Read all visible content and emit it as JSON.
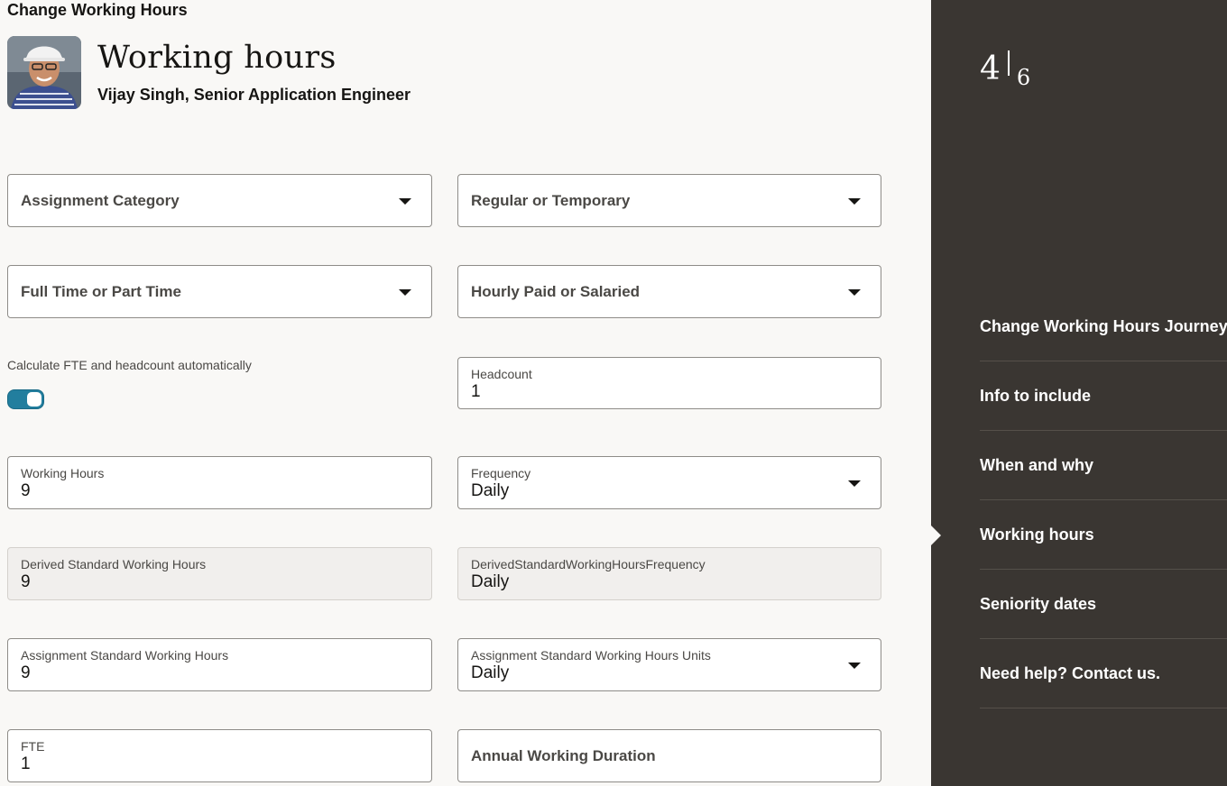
{
  "page": {
    "heading": "Change Working Hours",
    "title": "Working hours",
    "subtitle": "Vijay Singh, Senior Application Engineer"
  },
  "form": {
    "assignment_category": {
      "placeholder": "Assignment Category"
    },
    "regular_or_temporary": {
      "placeholder": "Regular or Temporary"
    },
    "full_or_part_time": {
      "placeholder": "Full Time or Part Time"
    },
    "hourly_or_salaried": {
      "placeholder": "Hourly Paid or Salaried"
    },
    "calculate_fte_toggle": {
      "label": "Calculate FTE and headcount automatically",
      "on": true
    },
    "headcount": {
      "label": "Headcount",
      "value": "1"
    },
    "working_hours": {
      "label": "Working Hours",
      "value": "9"
    },
    "frequency": {
      "label": "Frequency",
      "value": "Daily"
    },
    "derived_standard_working_hours": {
      "label": "Derived Standard Working Hours",
      "value": "9"
    },
    "derived_standard_working_hours_frequency": {
      "label": "DerivedStandardWorkingHoursFrequency",
      "value": "Daily"
    },
    "assignment_standard_working_hours": {
      "label": "Assignment Standard Working Hours",
      "value": "9"
    },
    "assignment_standard_working_hours_units": {
      "label": "Assignment Standard Working Hours Units",
      "value": "Daily"
    },
    "fte": {
      "label": "FTE",
      "value": "1"
    },
    "annual_working_duration": {
      "placeholder": "Annual Working Duration"
    }
  },
  "sidebar": {
    "step_current": "4",
    "step_total": "6",
    "items": [
      {
        "label": "Change Working Hours Journey"
      },
      {
        "label": "Info to include"
      },
      {
        "label": "When and why"
      },
      {
        "label": "Working hours",
        "active": true
      },
      {
        "label": "Seniority dates"
      },
      {
        "label": "Need help? Contact us."
      }
    ]
  },
  "colors": {
    "sidebar_bg": "#3a3632",
    "page_bg": "#f9f8f6",
    "toggle_on": "#227e9e"
  }
}
